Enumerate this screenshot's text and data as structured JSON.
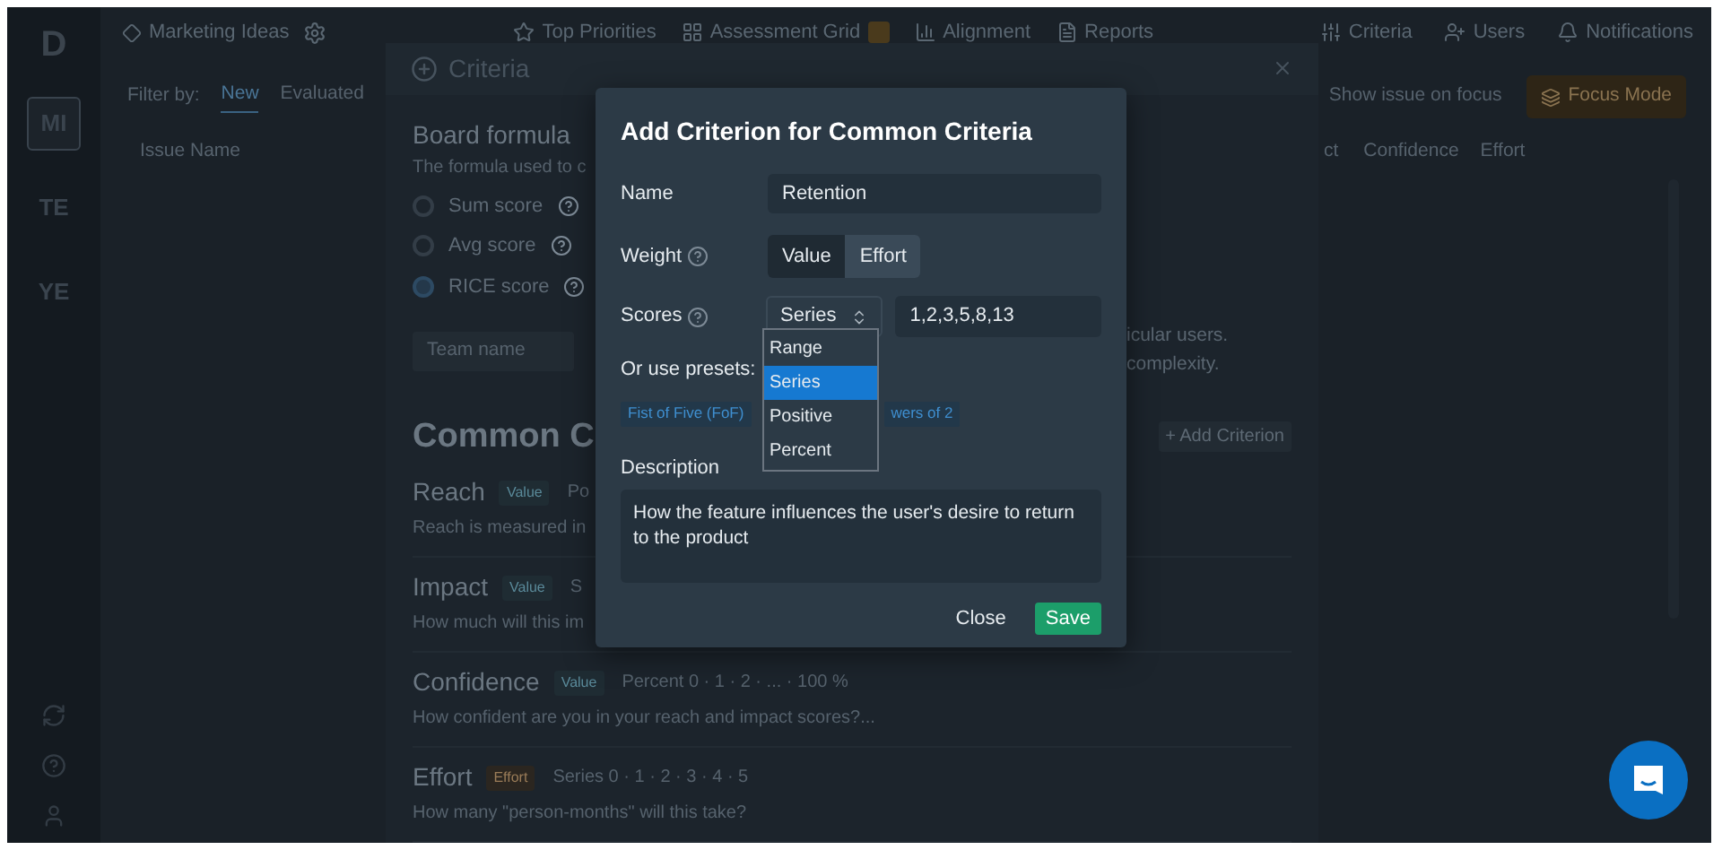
{
  "sidebar": {
    "logo": "D",
    "boards": [
      {
        "label": "MI",
        "selected": true
      },
      {
        "label": "TE",
        "selected": false
      },
      {
        "label": "YE",
        "selected": false
      }
    ]
  },
  "topbar": {
    "board_title": "Marketing Ideas",
    "nav": [
      {
        "label": "Top Priorities"
      },
      {
        "label": "Assessment Grid",
        "badge": true
      },
      {
        "label": "Alignment"
      },
      {
        "label": "Reports"
      },
      {
        "label": "Criteria"
      },
      {
        "label": "Users"
      },
      {
        "label": "Notifications"
      }
    ]
  },
  "filter_bar": {
    "label": "Filter by:",
    "filters": [
      {
        "label": "New",
        "selected": true
      },
      {
        "label": "Evaluated",
        "selected": false
      }
    ],
    "show_issue_label": "Show issue on focus",
    "focus_button": "Focus Mode"
  },
  "table": {
    "columns": [
      "Issue Name",
      "ct",
      "Confidence",
      "Effort"
    ]
  },
  "criteria_dialog": {
    "title": "Criteria",
    "formula_title": "Board formula",
    "formula_subtitle": "The formula used to c",
    "options": [
      {
        "label": "Sum score",
        "selected": false
      },
      {
        "label": "Avg score",
        "selected": false
      },
      {
        "label": "RICE score",
        "selected": true
      }
    ],
    "team_name_placeholder": "Team name",
    "notes": [
      "icular users.",
      "complexity."
    ],
    "section_title": "Common C",
    "add_button": "+ Add Criterion",
    "criteria": [
      {
        "name": "Reach",
        "weight": "Value",
        "kind": "value",
        "scale": "Po",
        "description": "Reach is measured in"
      },
      {
        "name": "Impact",
        "weight": "Value",
        "kind": "value",
        "scale": "S",
        "description": "How much will this im"
      },
      {
        "name": "Confidence",
        "weight": "Value",
        "kind": "value",
        "scale": "Percent 0 · 1 · 2 · ... · 100 %",
        "description": "How confident are you in your reach and impact scores?..."
      },
      {
        "name": "Effort",
        "weight": "Effort",
        "kind": "effort",
        "scale": "Series 0 · 1 · 2 · 3 · 4 · 5",
        "description": "How many \"person-months\" will this take?"
      }
    ]
  },
  "add_dialog": {
    "title": "Add Criterion for Common Criteria",
    "name_label": "Name",
    "name_value": "Retention",
    "weight_label": "Weight",
    "weight_options": [
      {
        "label": "Value",
        "selected": true
      },
      {
        "label": "Effort",
        "selected": false
      }
    ],
    "scores_label": "Scores",
    "scores_type": "Series",
    "scores_value": "1,2,3,5,8,13",
    "score_types": [
      {
        "label": "Range",
        "selected": false
      },
      {
        "label": "Series",
        "selected": true
      },
      {
        "label": "Positive",
        "selected": false
      },
      {
        "label": "Percent",
        "selected": false
      }
    ],
    "presets_label": "Or use presets:",
    "presets": [
      "Fist of Five (FoF)",
      "wers of 2"
    ],
    "description_label": "Description",
    "description_value": "How the feature influences the user's desire to return to the product",
    "close_button": "Close",
    "save_button": "Save"
  }
}
